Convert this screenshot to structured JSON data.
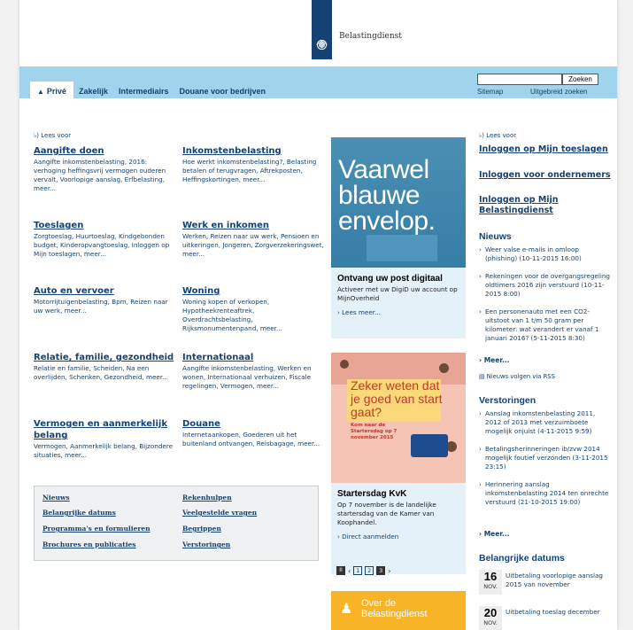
{
  "header": {
    "org_name": "Belastingdienst"
  },
  "nav": {
    "tabs": [
      {
        "label": "Privé",
        "active": true
      },
      {
        "label": "Zakelijk"
      },
      {
        "label": "Intermediairs"
      },
      {
        "label": "Douane voor bedrijven"
      }
    ],
    "search_placeholder": "",
    "search_button": "Zoeken",
    "sitemap": "Sitemap",
    "advanced_search": "Uitgebreid zoeken"
  },
  "read_aloud": "Lees voor",
  "blocks": [
    {
      "title": "Aangifte doen",
      "text": "Aangifte inkomstenbelasting, 2016: verhoging heffingsvrij vermogen ouderen vervalt, Voorlopige aanslag, Erfbelasting, meer..."
    },
    {
      "title": "Inkomstenbelasting",
      "text": "Hoe werkt inkomstenbelasting?, Belasting betalen of terugvragen, Aftrekposten, Heffingskortingen, meer..."
    },
    {
      "title": "Toeslagen",
      "text": "Zorgtoeslag, Huurtoeslag, Kindgebonden budget, Kinderopvangtoeslag, Inloggen op Mijn toeslagen, meer..."
    },
    {
      "title": "Werk en inkomen",
      "text": "Werken, Reizen naar uw werk, Pensioen en uitkeringen, Jongeren, Zorgverzekeringswet, meer..."
    },
    {
      "title": "Auto en vervoer",
      "text": "Motorrijtuigenbelasting, Bpm, Reizen naar uw werk, meer..."
    },
    {
      "title": "Woning",
      "text": "Woning kopen of verkopen, Hypotheekrenteaftrek, Overdrachtsbelasting, Rijksmonumentenpand, meer..."
    },
    {
      "title": "Relatie, familie, gezondheid",
      "text": "Relatie en familie, Scheiden, Na een overlijden, Schenken, Gezondheid, meer..."
    },
    {
      "title": "Internationaal",
      "text": "Aangifte inkomstenbelasting, Werken en wonen, Internationaal verhuizen, Fiscale regelingen, Vermogen, meer..."
    },
    {
      "title": "Vermogen en aanmerkelijk belang",
      "text": "Vermogen, Aanmerkelijk belang, Bijzondere situaties, meer..."
    },
    {
      "title": "Douane",
      "text": "Internetaankopen, Goederen uit het buitenland ontvangen, Reisbagage, meer..."
    }
  ],
  "quick_links": [
    {
      "label": "Nieuws"
    },
    {
      "label": "Rekenhulpen"
    },
    {
      "label": "Belangrijke datums"
    },
    {
      "label": "Veelgestelde vragen"
    },
    {
      "label": "Programma's en formulieren"
    },
    {
      "label": "Begrippen"
    },
    {
      "label": "Brochures en publicaties"
    },
    {
      "label": "Verstoringen"
    }
  ],
  "promo1": {
    "image_text": "Vaarwel blauwe envelop.",
    "title": "Ontvang uw post digitaal",
    "text": "Activeer met uw DigiD uw account op MijnOverheid",
    "link": "Lees meer..."
  },
  "promo2": {
    "image_text": "Zeker weten dat je goed van start gaat?",
    "image_sub": "Kom naar de Startersdag op 7 november 2015",
    "title": "Startersdag KvK",
    "text": "Op 7 november is de landelijke startersdag van de Kamer van Koophandel.",
    "link": "Direct aanmelden"
  },
  "carousel": {
    "pause": "II",
    "pages": [
      "1",
      "2",
      "3"
    ],
    "active": 3,
    "prev": "‹",
    "next": "›"
  },
  "promo3": {
    "text": "Over de Belastingdienst"
  },
  "right": {
    "login_toeslagen": "Inloggen op Mijn toeslagen",
    "login_ondernemers": "Inloggen voor ondernemers",
    "login_mijn": "Inloggen op Mijn Belastingdienst",
    "news_title": "Nieuws",
    "news": [
      "Weer valse e-mails in omloop (phishing) (10-11-2015 16:00)",
      "Rekeningen voor de overgangsregeling oldtimers 2016 zijn verstuurd (10-11-2015 8:00)",
      "Een personenauto met een CO2-uitstoot van 1 t/m 50 gram per kilometer: wat verandert er vanaf 1 januari 2016? (5-11-2015 8:30)"
    ],
    "more": "Meer...",
    "rss": "Nieuws volgen via RSS",
    "outages_title": "Verstoringen",
    "outages": [
      "Aanslag inkomstenbelasting 2011, 2012 of 2013 met verzuimboete mogelijk onjuist (4-11-2015 9:59)",
      "Betalingsherinneringen ib/zvw 2014 mogelijk foutief verzonden (3-11-2015 23:15)",
      "Herinnering aanslag inkomstenbelasting 2014 ten onrechte verstuurd (21-10-2015 19:00)"
    ],
    "dates_title": "Belangrijke datums",
    "dates": [
      {
        "day": "16",
        "month": "NOV.",
        "text": "Uitbetaling voorlopige aanslag 2015 van november"
      },
      {
        "day": "20",
        "month": "NOV.",
        "text": "Uitbetaling toeslag december"
      }
    ]
  }
}
